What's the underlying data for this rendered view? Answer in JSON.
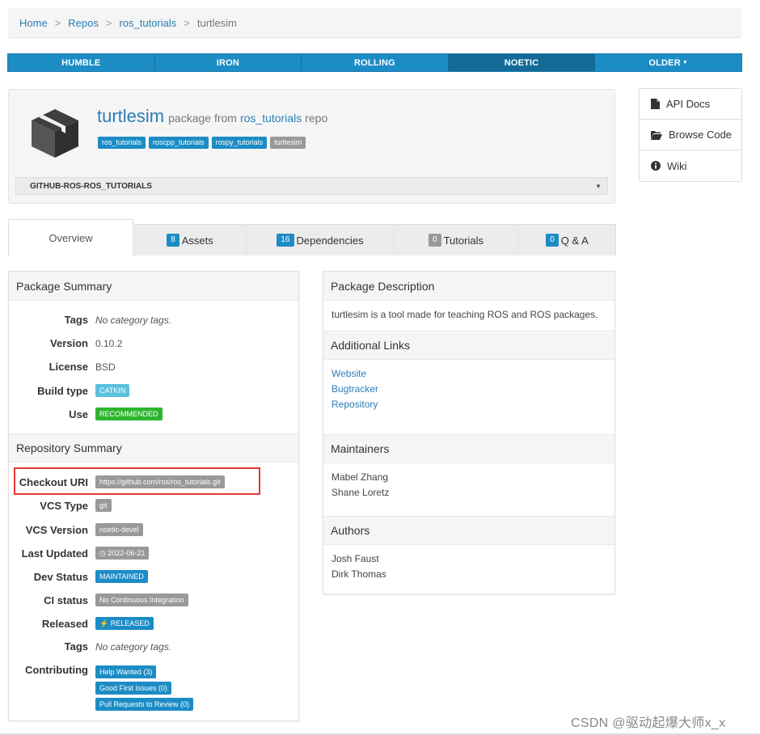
{
  "breadcrumb": {
    "items": [
      "Home",
      "Repos",
      "ros_tutorials"
    ],
    "current": "turtlesim",
    "separator": ">"
  },
  "distros": [
    "HUMBLE",
    "IRON",
    "ROLLING",
    "NOETIC",
    "OLDER"
  ],
  "active_distro": "NOETIC",
  "package": {
    "name": "turtlesim",
    "from_text": "package from",
    "repo": "ros_tutorials",
    "repo_suffix": "repo",
    "tags": [
      "ros_tutorials",
      "roscpp_tutorials",
      "rospy_tutorials",
      "turtlesim"
    ],
    "repo_select": "GITHUB-ROS-ROS_TUTORIALS"
  },
  "side_links": [
    {
      "label": "API Docs",
      "icon": "file-icon"
    },
    {
      "label": "Browse Code",
      "icon": "folder-open-icon"
    },
    {
      "label": "Wiki",
      "icon": "info-circle-icon"
    }
  ],
  "tabs": {
    "overview": "Overview",
    "assets": {
      "count": "8",
      "label": "Assets"
    },
    "dependencies": {
      "count": "16",
      "label": "Dependencies"
    },
    "tutorials": {
      "count": "0",
      "label": "Tutorials"
    },
    "qa": {
      "count": "0",
      "label": "Q & A"
    }
  },
  "package_summary": {
    "title": "Package Summary",
    "tags_label": "Tags",
    "tags_value": "No category tags.",
    "version_label": "Version",
    "version_value": "0.10.2",
    "license_label": "License",
    "license_value": "BSD",
    "build_label": "Build type",
    "build_value": "CATKIN",
    "use_label": "Use",
    "use_value": "RECOMMENDED"
  },
  "repo_summary": {
    "title": "Repository Summary",
    "checkout_label": "Checkout URI",
    "checkout_value": "https://github.com/ros/ros_tutorials.git",
    "vcs_type_label": "VCS Type",
    "vcs_type_value": "git",
    "vcs_version_label": "VCS Version",
    "vcs_version_value": "noetic-devel",
    "updated_label": "Last Updated",
    "updated_value": "2022-06-21",
    "dev_label": "Dev Status",
    "dev_value": "MAINTAINED",
    "ci_label": "CI status",
    "ci_value": "No Continuous Integration",
    "released_label": "Released",
    "released_value": "RELEASED",
    "tags_label": "Tags",
    "tags_value": "No category tags.",
    "contrib_label": "Contributing",
    "contrib_items": [
      "Help Wanted (3)",
      "Good First Issues (0)",
      "Pull Requests to Review (0)"
    ]
  },
  "description": {
    "title": "Package Description",
    "text": "turtlesim is a tool made for teaching ROS and ROS packages."
  },
  "additional_links": {
    "title": "Additional Links",
    "links": [
      "Website",
      "Bugtracker",
      "Repository"
    ]
  },
  "maintainers": {
    "title": "Maintainers",
    "names": [
      "Mabel Zhang",
      "Shane Loretz"
    ]
  },
  "authors": {
    "title": "Authors",
    "names": [
      "Josh Faust",
      "Dirk Thomas"
    ]
  },
  "watermark": "CSDN @驱动起爆大师x_x",
  "colors": {
    "primary": "#1c8cc5",
    "active_nav": "#136a96",
    "success": "#2db52d",
    "info": "#5bc0de",
    "highlight": "#e53935"
  }
}
